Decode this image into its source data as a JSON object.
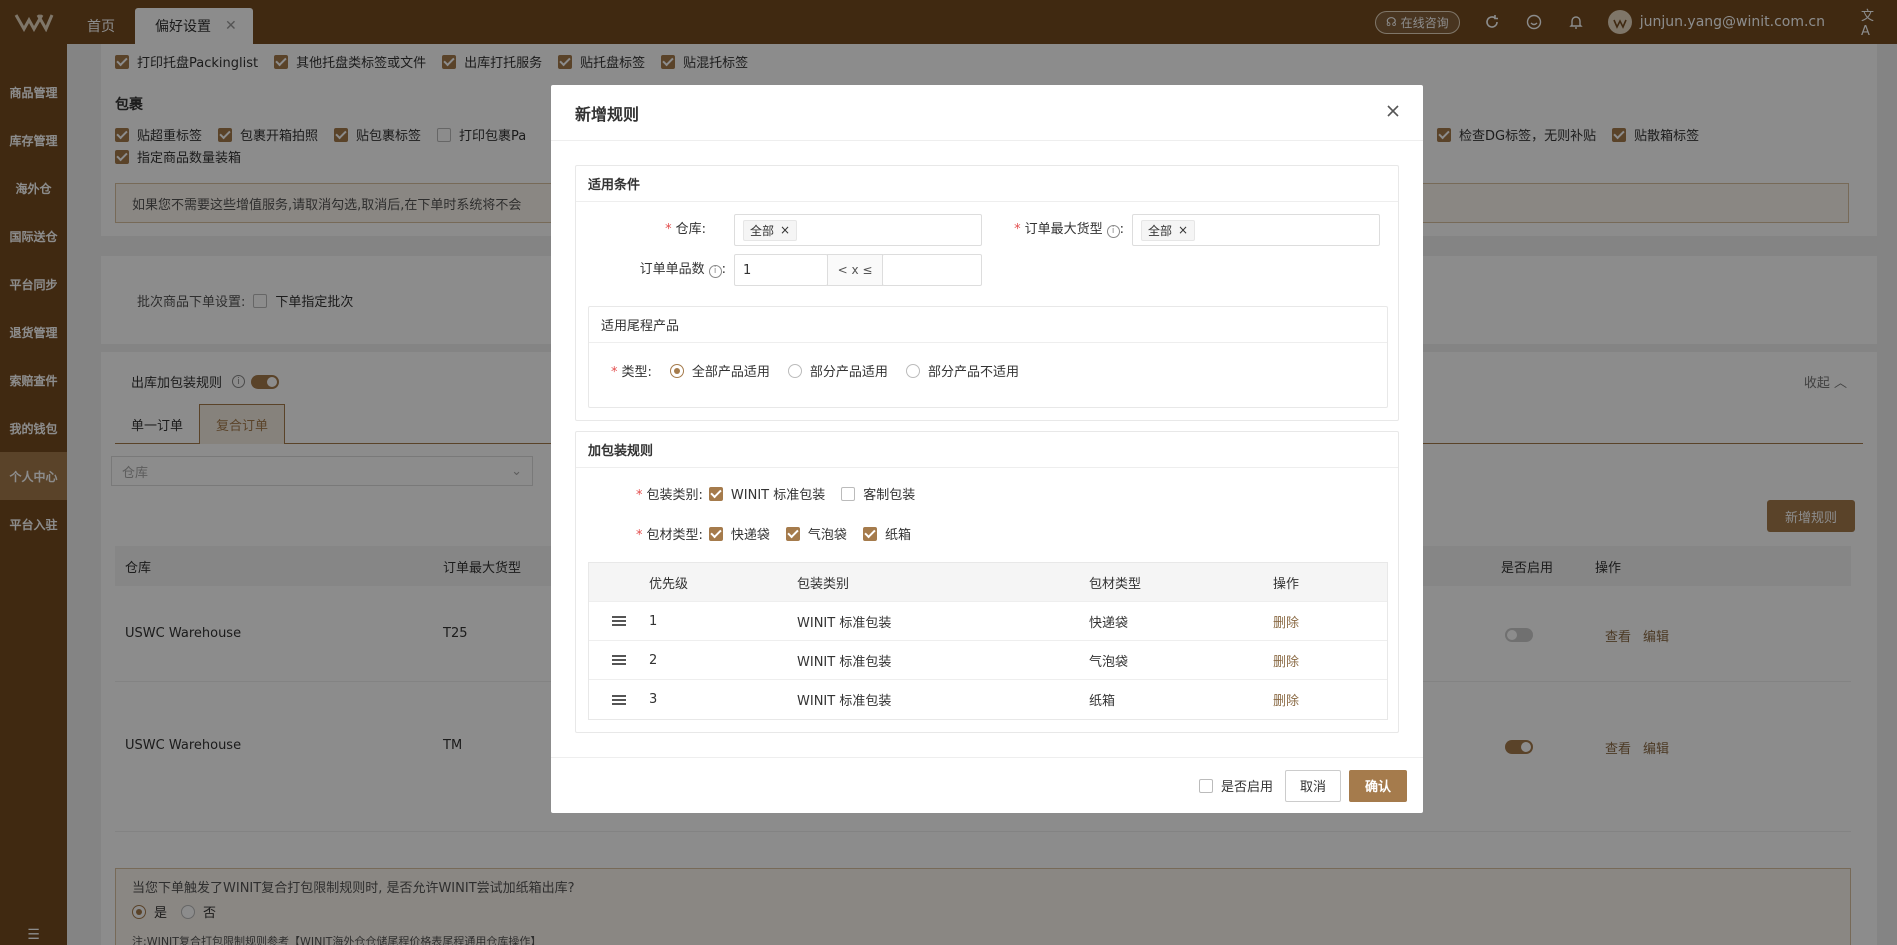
{
  "topbar": {
    "tabs": [
      {
        "label": "首页"
      },
      {
        "label": "偏好设置"
      }
    ],
    "consult_label": "在线咨询",
    "user_email": "junjun.yang@winit.com.cn"
  },
  "sidebar": {
    "items": [
      {
        "label": "商品管理"
      },
      {
        "label": "库存管理"
      },
      {
        "label": "海外仓"
      },
      {
        "label": "国际送仓"
      },
      {
        "label": "平台同步"
      },
      {
        "label": "退货管理"
      },
      {
        "label": "索赔查件"
      },
      {
        "label": "我的钱包"
      },
      {
        "label": "个人中心"
      },
      {
        "label": "平台入驻"
      }
    ]
  },
  "background": {
    "pallet_options": [
      {
        "label": "打印托盘Packinglist",
        "checked": true
      },
      {
        "label": "其他托盘类标签或文件",
        "checked": true
      },
      {
        "label": "出库打托服务",
        "checked": true
      },
      {
        "label": "贴托盘标签",
        "checked": true
      },
      {
        "label": "贴混托标签",
        "checked": true
      }
    ],
    "package_title": "包裹",
    "package_options": [
      {
        "label": "贴超重标签",
        "checked": true
      },
      {
        "label": "包裹开箱拍照",
        "checked": true
      },
      {
        "label": "贴包裹标签",
        "checked": true
      },
      {
        "label": "打印包裹Pa",
        "checked": false
      }
    ],
    "package_options_right": [
      {
        "label": "检查DG标签，无则补贴",
        "checked": true
      },
      {
        "label": "贴散箱标签",
        "checked": true
      }
    ],
    "package_option_row2": {
      "label": "指定商品数量装箱",
      "checked": true
    },
    "notice_text": "如果您不需要这些增值服务,请取消勾选,取消后,在下单时系统将不会",
    "batch_label": "批次商品下单设置:",
    "batch_option": "下单指定批次",
    "packing_rule_label": "出库加包装规则",
    "collapse_label": "收起",
    "order_tabs": [
      {
        "label": "单一订单"
      },
      {
        "label": "复合订单"
      }
    ],
    "warehouse_placeholder": "仓库",
    "add_rule_button": "新增规则",
    "table_headers": {
      "warehouse": "仓库",
      "max_size": "订单最大货型",
      "enabled": "是否启用",
      "actions": "操作"
    },
    "rows": [
      {
        "warehouse": "USWC Warehouse",
        "size": "T25",
        "enabled": false,
        "view": "查看",
        "edit": "编辑"
      },
      {
        "warehouse": "USWC Warehouse",
        "size": "TM",
        "enabled": true,
        "view": "查看",
        "edit": "编辑"
      }
    ],
    "composite_question": "当您下单触发了WINIT复合打包限制规则时, 是否允许WINIT尝试加纸箱出库?",
    "yes_label": "是",
    "no_label": "否",
    "note_text": "注:WINIT复合打包限制规则参考【WINIT海外仓仓储尾程价格表尾程通用仓库操作】"
  },
  "modal": {
    "title": "新增规则",
    "conditions_title": "适用条件",
    "warehouse_label": "仓库",
    "warehouse_tag": "全部",
    "max_size_label": "订单最大货型",
    "max_size_tag": "全部",
    "item_count_label": "订单单品数",
    "item_count_min": "1",
    "item_count_op": "< x ≤",
    "item_count_max": "",
    "last_mile_title": "适用尾程产品",
    "type_label": "类型",
    "type_options": [
      {
        "label": "全部产品适用",
        "selected": true
      },
      {
        "label": "部分产品适用",
        "selected": false
      },
      {
        "label": "部分产品不适用",
        "selected": false
      }
    ],
    "packing_title": "加包装规则",
    "pack_category_label": "包装类别",
    "pack_categories": [
      {
        "label": "WINIT 标准包装",
        "checked": true
      },
      {
        "label": "客制包装",
        "checked": false
      }
    ],
    "material_label": "包材类型",
    "materials": [
      {
        "label": "快递袋",
        "checked": true
      },
      {
        "label": "气泡袋",
        "checked": true
      },
      {
        "label": "纸箱",
        "checked": true
      }
    ],
    "table_headers": {
      "priority": "优先级",
      "category": "包装类别",
      "material": "包材类型",
      "action": "操作"
    },
    "rows": [
      {
        "priority": "1",
        "category": "WINIT 标准包装",
        "material": "快递袋",
        "action": "删除"
      },
      {
        "priority": "2",
        "category": "WINIT 标准包装",
        "material": "气泡袋",
        "action": "删除"
      },
      {
        "priority": "3",
        "category": "WINIT 标准包装",
        "material": "纸箱",
        "action": "删除"
      }
    ],
    "enable_label": "是否启用",
    "cancel_label": "取消",
    "confirm_label": "确认"
  },
  "colors": {
    "brand": "#754c20",
    "accent": "#a57b4c",
    "required": "#e34d4d"
  }
}
